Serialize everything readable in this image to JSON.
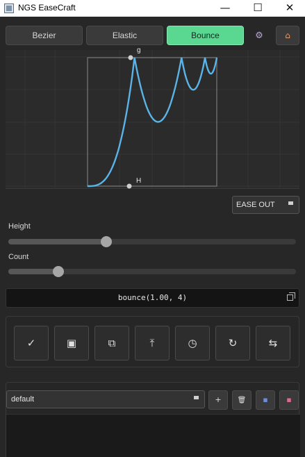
{
  "window": {
    "title": "NGS EaseCraft",
    "minimize_glyph": "—",
    "maximize_glyph": "☐",
    "close_glyph": "✕"
  },
  "tabs": [
    {
      "label": "Bezier",
      "active": false
    },
    {
      "label": "Elastic",
      "active": false
    },
    {
      "label": "Bounce",
      "active": true
    }
  ],
  "toolbar": {
    "settings_icon": "gear-icon",
    "home_icon": "home-icon",
    "settings_glyph": "⚙",
    "home_glyph": "⌂"
  },
  "graph": {
    "handle_top_label": "g",
    "handle_bottom_label": "H",
    "curve_color": "#5ab4e8"
  },
  "mode_select": {
    "value": "EASE OUT"
  },
  "sliders": {
    "height": {
      "label": "Height",
      "value": 1.0,
      "fraction": 0.34
    },
    "count": {
      "label": "Count",
      "value": 4,
      "fraction": 0.17
    }
  },
  "expression": {
    "text": "bounce(1.00, 4)",
    "copy_icon": "copy-icon"
  },
  "actions": [
    {
      "name": "apply",
      "icon": "check-icon",
      "glyph": "✓"
    },
    {
      "name": "save",
      "icon": "save-icon",
      "glyph": "▣"
    },
    {
      "name": "duplicate",
      "icon": "duplicate-icon",
      "glyph": "⧉"
    },
    {
      "name": "export",
      "icon": "upload-icon",
      "glyph": "⤒"
    },
    {
      "name": "history",
      "icon": "history-icon",
      "glyph": "◷"
    },
    {
      "name": "reset",
      "icon": "refresh-icon",
      "glyph": "↻"
    },
    {
      "name": "swap",
      "icon": "swap-icon",
      "glyph": "⇆"
    }
  ],
  "presets": {
    "selected": "default",
    "add_label": "+",
    "delete_icon": "trash-icon",
    "import_icon": "import-icon",
    "export_icon": "export-icon",
    "delete_glyph": "🗑",
    "import_glyph": "▪",
    "export_glyph": "▪"
  },
  "accent": "#5ad892"
}
